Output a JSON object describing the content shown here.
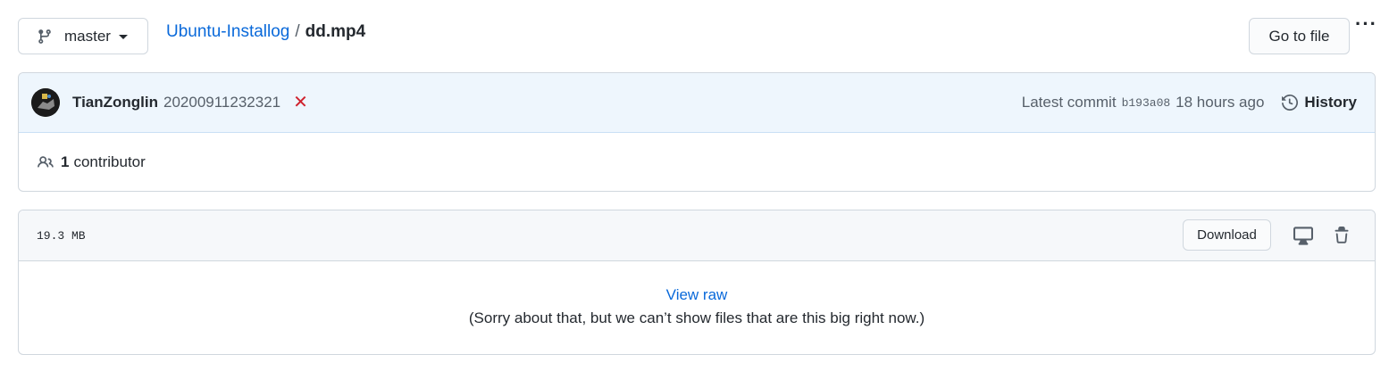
{
  "branch": {
    "name": "master",
    "icon": "git-branch-icon"
  },
  "breadcrumb": {
    "repo": "Ubuntu-Installog",
    "separator": "/",
    "file": "dd.mp4"
  },
  "toolbar": {
    "goto_label": "Go to file",
    "more_label": "···"
  },
  "commit": {
    "author": "TianZonglin",
    "message": "20200911232321",
    "status": "✕",
    "latest_label": "Latest commit",
    "sha": "b193a08",
    "time": "18 hours ago",
    "history_label": "History"
  },
  "contributors": {
    "count": "1",
    "label": "contributor"
  },
  "file": {
    "size": "19.3 MB",
    "download_label": "Download",
    "view_raw": "View raw",
    "notice": "(Sorry about that, but we can’t show files that are this big right now.)"
  },
  "colors": {
    "link": "#0969da",
    "commit_bg": "#eef6fd",
    "error": "#cf222e"
  }
}
